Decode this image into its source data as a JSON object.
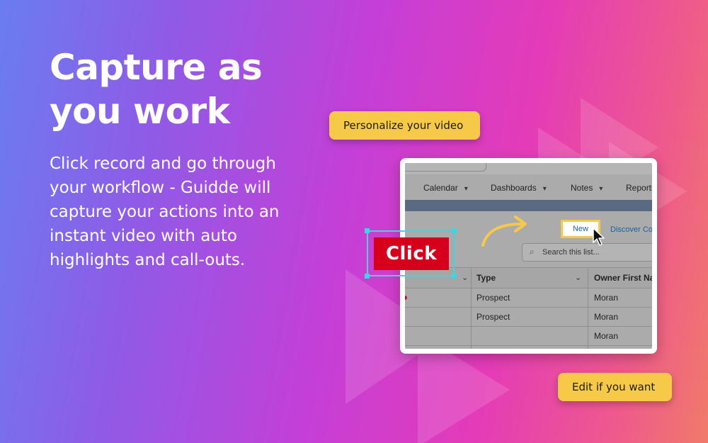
{
  "hero": {
    "title": "Capture as you work",
    "body": "Click record and go through your workflow - Guidde will capture your actions into an instant video with auto highlights and call-outs."
  },
  "callouts": {
    "personalize": "Personalize your video",
    "edit": "Edit if you want",
    "click": "Click"
  },
  "app": {
    "nav": [
      "Calendar",
      "Dashboards",
      "Notes",
      "Reports"
    ],
    "new_button": "New",
    "discover_button": "Discover Co",
    "search_placeholder": "Search this list...",
    "columns": [
      "Type",
      "Owner First Na"
    ],
    "rows": [
      {
        "type": "Prospect",
        "owner": "Moran"
      },
      {
        "type": "Prospect",
        "owner": "Moran"
      },
      {
        "type": "",
        "owner": "Moran"
      }
    ]
  },
  "colors": {
    "callout_yellow": "#f7c948",
    "click_red": "#d6001c",
    "selection_cyan": "#3fd3e3",
    "link_blue": "#1b5fae"
  },
  "icons": [
    "search-icon",
    "chevron-down-icon",
    "curved-arrow-icon",
    "cursor-icon"
  ]
}
